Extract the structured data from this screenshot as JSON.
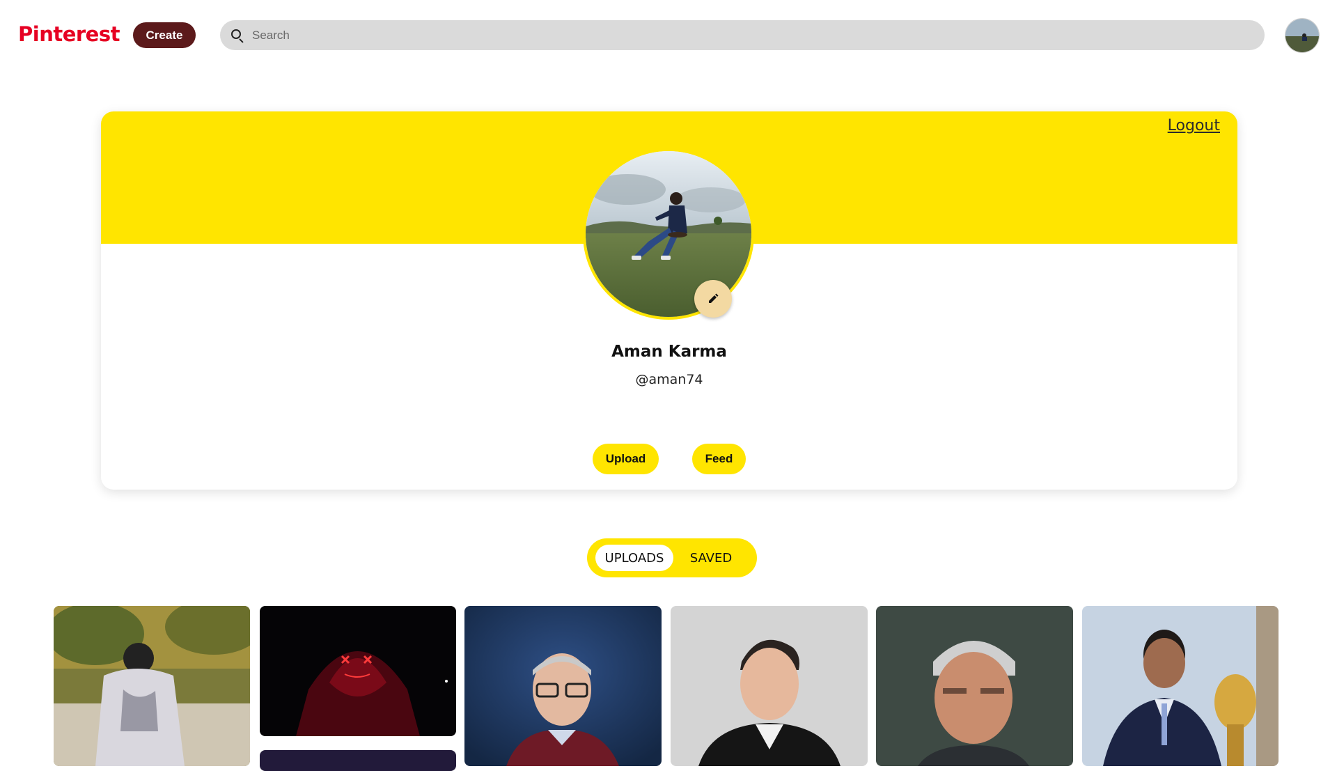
{
  "header": {
    "logo": "Pinterest",
    "create_label": "Create",
    "search_placeholder": "Search",
    "search_value": ""
  },
  "profile": {
    "logout_label": "Logout",
    "name": "Aman Karma",
    "handle": "@aman74",
    "upload_label": "Upload",
    "feed_label": "Feed"
  },
  "tabs": [
    {
      "label": "UPLOADS",
      "active": true
    },
    {
      "label": "SAVED",
      "active": false
    }
  ],
  "colors": {
    "brand": "#e60023",
    "accent": "#ffe500",
    "create_button": "#5c1a1b"
  },
  "gallery": [
    {
      "image": "person-in-hoodie-under-trees"
    },
    {
      "image": "glowing-neon-mask"
    },
    {
      "image": "bill-gates-portrait"
    },
    {
      "image": "elon-musk-portrait"
    },
    {
      "image": "ratan-tata-portrait"
    },
    {
      "image": "ms-dhoni-with-trophy"
    },
    {
      "image": "dark-purple-image"
    }
  ]
}
